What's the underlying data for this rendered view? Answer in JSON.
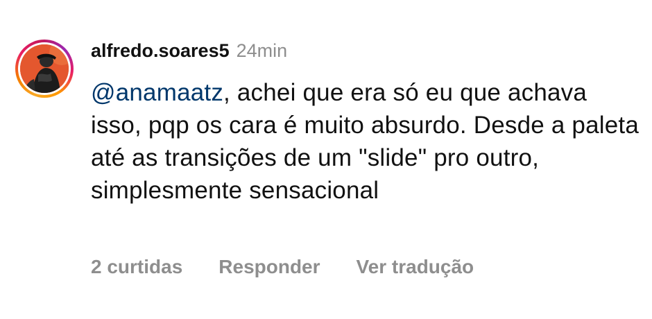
{
  "comment": {
    "username": "alfredo.soares5",
    "time": "24min",
    "mention": "@anamaatz",
    "text_after_mention": ", achei que era só eu que achava isso, pqp os cara é muito absurdo. Desde a paleta até as transições de um \"slide\" pro outro, simplesmente sensacional",
    "actions": {
      "likes": "2 curtidas",
      "reply": "Responder",
      "translate": "Ver tradução"
    }
  },
  "colors": {
    "mention": "#00376b",
    "secondary_text": "#8e8e8e",
    "primary_text": "#111111",
    "avatar_background": "#e4572e"
  }
}
